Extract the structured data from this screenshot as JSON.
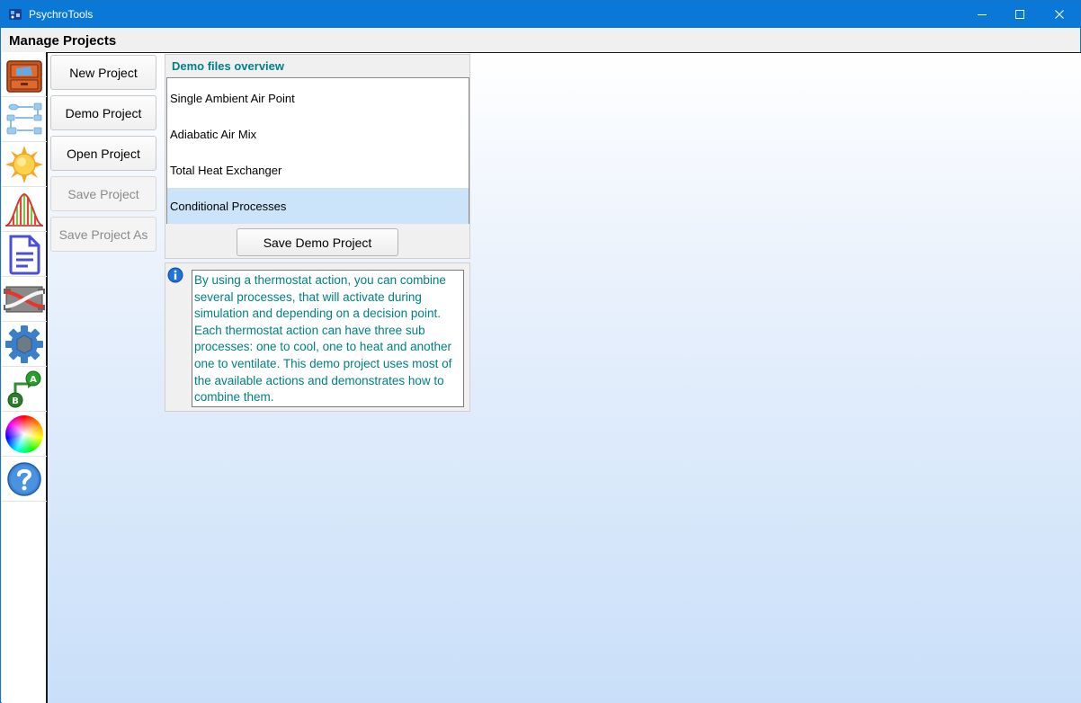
{
  "window": {
    "title": "PsychroTools",
    "accent_color": "#0a78d7"
  },
  "page": {
    "title": "Manage Projects"
  },
  "rail": {
    "items": [
      {
        "icon": "file-cabinet-icon",
        "label": "Projects"
      },
      {
        "icon": "process-flow-icon",
        "label": "Processes"
      },
      {
        "icon": "sun-icon",
        "label": "Climate"
      },
      {
        "icon": "distribution-chart-icon",
        "label": "Statistics"
      },
      {
        "icon": "document-icon",
        "label": "Reports"
      },
      {
        "icon": "heat-exchanger-icon",
        "label": "Heat Exchanger"
      },
      {
        "icon": "gear-icon",
        "label": "Settings"
      },
      {
        "icon": "a-to-b-icon",
        "label": "Conversion"
      },
      {
        "icon": "color-wheel-icon",
        "label": "Colors"
      },
      {
        "icon": "help-icon",
        "label": "Help"
      }
    ]
  },
  "sidebar": {
    "new_project": "New Project",
    "demo_project": "Demo Project",
    "open_project": "Open Project",
    "save_project": "Save Project",
    "save_project_as": "Save Project As"
  },
  "demo": {
    "header": "Demo files overview",
    "items": [
      {
        "label": "Single Ambient Air Point",
        "selected": false
      },
      {
        "label": "Adiabatic Air Mix",
        "selected": false
      },
      {
        "label": "Total Heat Exchanger",
        "selected": false
      },
      {
        "label": "Conditional Processes",
        "selected": true
      }
    ],
    "save_button": "Save Demo Project",
    "description": "By using a thermostat action, you can combine several processes, that will activate during simulation and depending on a decision point. Each thermostat action can have three sub processes: one to cool, one to heat and another one to ventilate. This demo project uses most of the available actions and demonstrates how to combine them."
  }
}
